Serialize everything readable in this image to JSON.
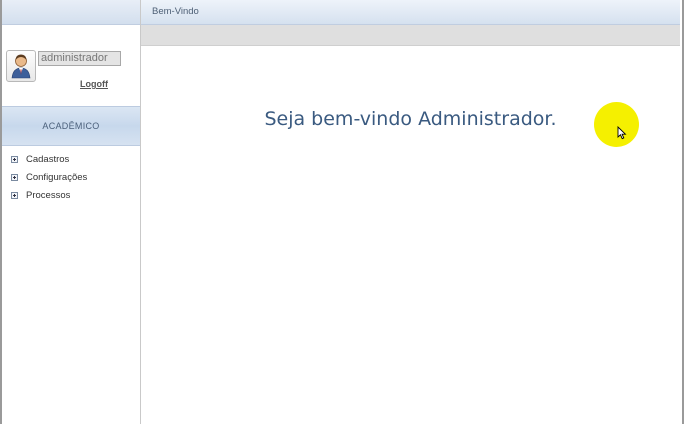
{
  "sidebar": {
    "username": "administrador",
    "logoff_label": "Logoff",
    "section_label": "ACADÊMICO",
    "menu": [
      {
        "label": "Cadastros"
      },
      {
        "label": "Configurações"
      },
      {
        "label": "Processos"
      }
    ]
  },
  "header": {
    "tab_title": "Bem-Vindo"
  },
  "main": {
    "welcome_text": "Seja bem-vindo Administrador."
  },
  "colors": {
    "accent": "#3a5a80",
    "cursor_highlight": "#f5f000"
  },
  "icons": [
    "user-avatar-icon",
    "expand-plus-icon",
    "mouse-cursor-icon"
  ]
}
